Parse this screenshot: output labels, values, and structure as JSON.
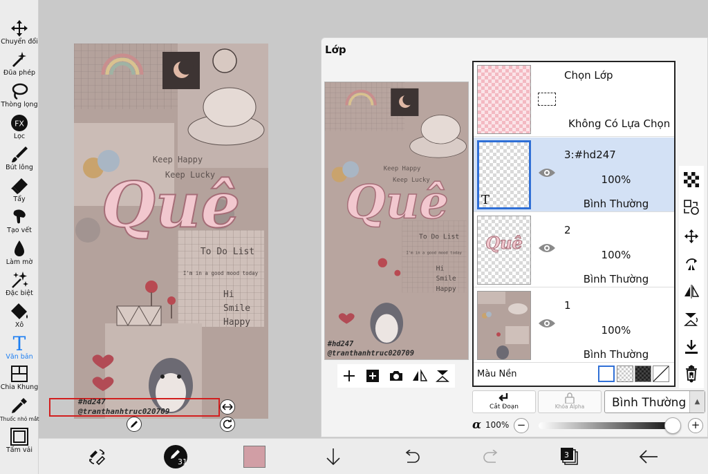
{
  "toolbar": {
    "tools": [
      {
        "label": "Chuyển đổi",
        "icon": "move-icon"
      },
      {
        "label": "Đũa phép",
        "icon": "magic-wand-icon"
      },
      {
        "label": "Thòng lọng",
        "icon": "lasso-icon"
      },
      {
        "label": "Lọc",
        "icon": "fx-filter-icon",
        "glyph": "FX"
      },
      {
        "label": "Bút lông",
        "icon": "brush-icon"
      },
      {
        "label": "Tẩy",
        "icon": "eraser-icon"
      },
      {
        "label": "Tạo vết",
        "icon": "smudge-icon"
      },
      {
        "label": "Làm mờ",
        "icon": "blur-drop-icon"
      },
      {
        "label": "Đặc biệt",
        "icon": "special-sparkle-icon"
      },
      {
        "label": "Xô",
        "icon": "bucket-icon"
      },
      {
        "label": "Văn bản",
        "icon": "text-tool-icon",
        "glyph": "T",
        "active": true
      },
      {
        "label": "Chia Khung",
        "icon": "frame-divider-icon"
      },
      {
        "label": "Thuốc nhỏ mắt",
        "icon": "eyedropper-icon"
      },
      {
        "label": "Tấm vải",
        "icon": "canvas-icon"
      }
    ]
  },
  "canvas_art": {
    "keep_happy": "Keep Happy",
    "keep_lucky": "Keep Lucky",
    "title": "Quê",
    "todo": "To Do List",
    "mood": "I'm in a good mood today",
    "hi": "Hi",
    "smile": "Smile",
    "happy": "Happy",
    "tag": "#hd247",
    "credit": "@tranthanhtruc020709"
  },
  "layer_panel": {
    "title": "Lớp",
    "selection_layer": {
      "name": "Chọn Lớp",
      "status": "Không Có Lựa Chọn"
    },
    "layers": [
      {
        "name": "3:#hd247",
        "opacity": "100%",
        "blend": "Bình Thường",
        "selected": true,
        "type_badge": "T"
      },
      {
        "name": "2",
        "opacity": "100%",
        "blend": "Bình Thường",
        "selected": false,
        "thumb_text": "Quê"
      },
      {
        "name": "1",
        "opacity": "100%",
        "blend": "Bình Thường",
        "selected": false
      }
    ],
    "background_label": "Màu Nền",
    "clip_label": "Cắt Đoạn",
    "alpha_lock_label": "Khóa Alpha",
    "blend_mode": "Bình Thường",
    "alpha_symbol": "α",
    "alpha_value": "100%",
    "alpha_level": 1.0,
    "minus": "−",
    "plus": "+"
  },
  "bottombar": {
    "brush_size": "31",
    "layer_count": "3",
    "current_color": "#d19ea5"
  },
  "colors": {
    "accent": "#1d7ef2",
    "selected_row": "#d3e1f5",
    "selection_box": "#d21e1e"
  }
}
